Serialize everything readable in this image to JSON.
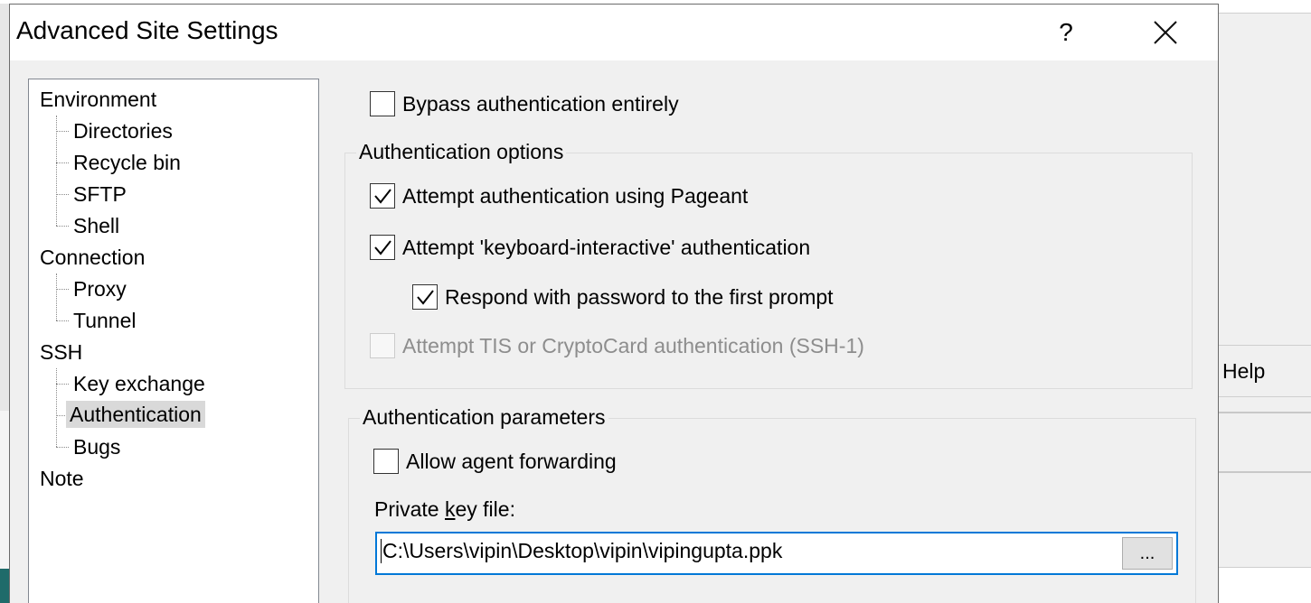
{
  "dialog": {
    "title": "Advanced Site Settings",
    "help_glyph": "?",
    "close_icon": "close-icon"
  },
  "background": {
    "help_label": "Help"
  },
  "tree": {
    "items": [
      {
        "label": "Environment",
        "level": 0
      },
      {
        "label": "Directories",
        "level": 1
      },
      {
        "label": "Recycle bin",
        "level": 1
      },
      {
        "label": "SFTP",
        "level": 1
      },
      {
        "label": "Shell",
        "level": 1
      },
      {
        "label": "Connection",
        "level": 0
      },
      {
        "label": "Proxy",
        "level": 1
      },
      {
        "label": "Tunnel",
        "level": 1
      },
      {
        "label": "SSH",
        "level": 0
      },
      {
        "label": "Key exchange",
        "level": 1
      },
      {
        "label": "Authentication",
        "level": 1,
        "selected": true
      },
      {
        "label": "Bugs",
        "level": 1
      },
      {
        "label": "Note",
        "level": 0
      }
    ]
  },
  "auth": {
    "bypass": {
      "label": "Bypass authentication entirely",
      "checked": false
    },
    "options_group": {
      "title": "Authentication options",
      "pageant": {
        "label": "Attempt authentication using Pageant",
        "checked": true
      },
      "keyboard_interactive": {
        "label": "Attempt 'keyboard-interactive' authentication",
        "checked": true
      },
      "respond_password": {
        "label": "Respond with password to the first prompt",
        "checked": true
      },
      "tis": {
        "label": "Attempt TIS or CryptoCard authentication (SSH-1)",
        "checked": false,
        "disabled": true
      }
    },
    "params_group": {
      "title": "Authentication parameters",
      "agent_forwarding": {
        "label": "Allow agent forwarding",
        "checked": false
      },
      "private_key_label_before": "Private ",
      "private_key_label_accel": "k",
      "private_key_label_after": "ey file:",
      "private_key_value": "C:\\Users\\vipin\\Desktop\\vipin\\vipingupta.ppk",
      "browse_label": "..."
    }
  }
}
